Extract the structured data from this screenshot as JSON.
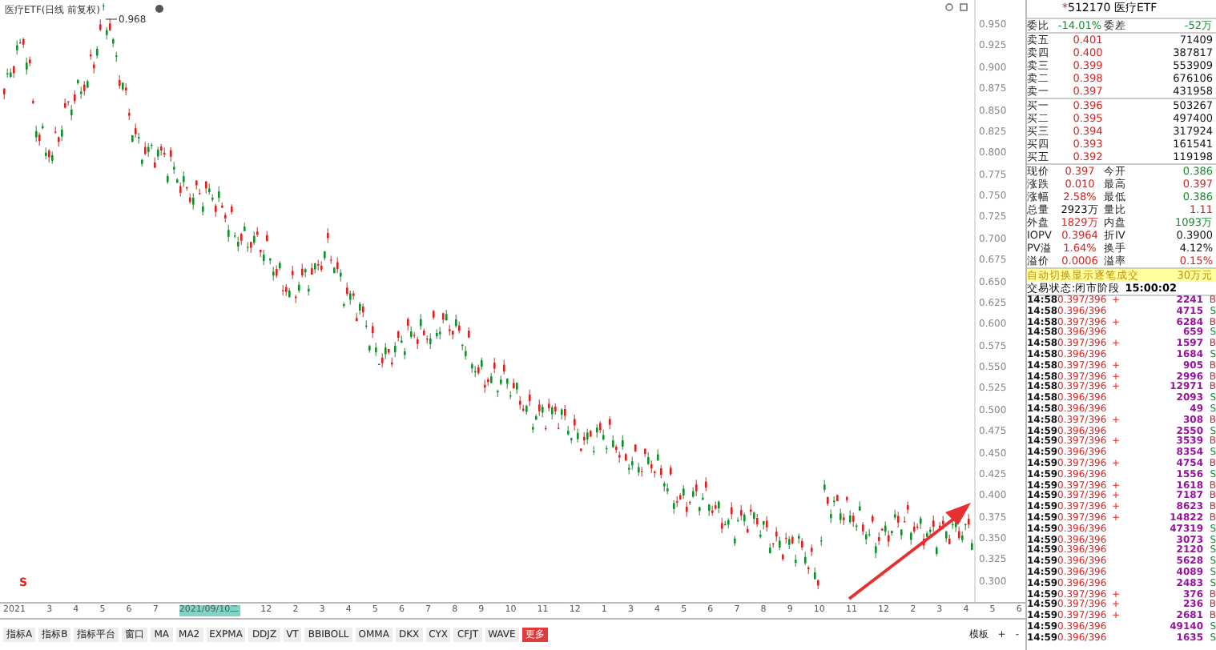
{
  "chart": {
    "title": "医疗ETF(日线 前复权)",
    "peak_label": "0.968",
    "event_marker": "S",
    "price_axis": [
      "0.950",
      "0.925",
      "0.900",
      "0.875",
      "0.850",
      "0.825",
      "0.800",
      "0.775",
      "0.750",
      "0.725",
      "0.700",
      "0.675",
      "0.650",
      "0.625",
      "0.600",
      "0.575",
      "0.550",
      "0.525",
      "0.500",
      "0.475",
      "0.450",
      "0.425",
      "0.400",
      "0.375",
      "0.350",
      "0.325",
      "0.300"
    ],
    "time_axis": [
      {
        "label": "2021",
        "selected": false
      },
      {
        "label": "3",
        "selected": false
      },
      {
        "label": "4",
        "selected": false
      },
      {
        "label": "5",
        "selected": false
      },
      {
        "label": "6",
        "selected": false
      },
      {
        "label": "7",
        "selected": false
      },
      {
        "label": "2021/09/10二",
        "selected": true
      },
      {
        "label": "12",
        "selected": false
      },
      {
        "label": "2",
        "selected": false
      },
      {
        "label": "3",
        "selected": false
      },
      {
        "label": "4",
        "selected": false
      },
      {
        "label": "5",
        "selected": false
      },
      {
        "label": "6",
        "selected": false
      },
      {
        "label": "7",
        "selected": false
      },
      {
        "label": "8",
        "selected": false
      },
      {
        "label": "9",
        "selected": false
      },
      {
        "label": "10",
        "selected": false
      },
      {
        "label": "11",
        "selected": false
      },
      {
        "label": "12",
        "selected": false
      },
      {
        "label": "1",
        "selected": false
      },
      {
        "label": "3",
        "selected": false
      },
      {
        "label": "4",
        "selected": false
      },
      {
        "label": "5",
        "selected": false
      },
      {
        "label": "6",
        "selected": false
      },
      {
        "label": "7",
        "selected": false
      },
      {
        "label": "8",
        "selected": false
      },
      {
        "label": "9",
        "selected": false
      },
      {
        "label": "10",
        "selected": false
      },
      {
        "label": "11",
        "selected": false
      },
      {
        "label": "12",
        "selected": false
      },
      {
        "label": "2",
        "selected": false
      },
      {
        "label": "3",
        "selected": false
      },
      {
        "label": "4",
        "selected": false
      },
      {
        "label": "5",
        "selected": false
      },
      {
        "label": "6",
        "selected": false
      }
    ]
  },
  "indicator_tabs": [
    {
      "label": "指标A",
      "selected": false
    },
    {
      "label": "指标B",
      "selected": false
    },
    {
      "label": "指标平台",
      "selected": false
    },
    {
      "label": "窗口",
      "selected": false
    },
    {
      "label": "MA",
      "selected": false
    },
    {
      "label": "MA2",
      "selected": false
    },
    {
      "label": "EXPMA",
      "selected": false
    },
    {
      "label": "DDJZ",
      "selected": false
    },
    {
      "label": "VT",
      "selected": false
    },
    {
      "label": "BBIBOLL",
      "selected": false
    },
    {
      "label": "OMMA",
      "selected": false
    },
    {
      "label": "DKX",
      "selected": false
    },
    {
      "label": "CYX",
      "selected": false
    },
    {
      "label": "CFJT",
      "selected": false
    },
    {
      "label": "WAVE",
      "selected": false
    },
    {
      "label": "更多",
      "selected": true
    }
  ],
  "template_controls": [
    "模板",
    "+",
    "-"
  ],
  "quote_panel": {
    "title": "512170 医疗ETF",
    "star": "*",
    "order_ratio": [
      {
        "label": "委比",
        "value": "-14.01%",
        "color": "#10902c"
      },
      {
        "label": "委差",
        "value": "-52万",
        "color": "#10902c"
      }
    ],
    "asks": [
      {
        "label": "卖五",
        "price": "0.401",
        "volume": "71409"
      },
      {
        "label": "卖四",
        "price": "0.400",
        "volume": "387817"
      },
      {
        "label": "卖三",
        "price": "0.399",
        "volume": "553909"
      },
      {
        "label": "卖二",
        "price": "0.398",
        "volume": "676106"
      },
      {
        "label": "卖一",
        "price": "0.397",
        "volume": "431958"
      }
    ],
    "bids": [
      {
        "label": "买一",
        "price": "0.396",
        "volume": "503267"
      },
      {
        "label": "买二",
        "price": "0.395",
        "volume": "497400"
      },
      {
        "label": "买三",
        "price": "0.394",
        "volume": "317924"
      },
      {
        "label": "买四",
        "price": "0.393",
        "volume": "161541"
      },
      {
        "label": "买五",
        "price": "0.392",
        "volume": "119198"
      }
    ],
    "stats": [
      {
        "label": "现价",
        "value": "0.397",
        "color": "#e02020"
      },
      {
        "label": "今开",
        "value": "0.386",
        "color": "#10902c"
      },
      {
        "label": "涨跌",
        "value": "0.010",
        "color": "#e02020"
      },
      {
        "label": "最高",
        "value": "0.397",
        "color": "#e02020"
      },
      {
        "label": "涨幅",
        "value": "2.58%",
        "color": "#e02020"
      },
      {
        "label": "最低",
        "value": "0.386",
        "color": "#10902c"
      },
      {
        "label": "总量",
        "value": "2923万",
        "color": "#111111"
      },
      {
        "label": "量比",
        "value": "1.11",
        "color": "#e02020"
      },
      {
        "label": "外盘",
        "value": "1829万",
        "color": "#e02020"
      },
      {
        "label": "内盘",
        "value": "1093万",
        "color": "#10902c"
      },
      {
        "label": "IOPV",
        "value": "0.3964",
        "color": "#e02020"
      },
      {
        "label": "折IV",
        "value": "0.3900",
        "color": "#111111"
      },
      {
        "label": "PV溢",
        "value": "1.64%",
        "color": "#e02020"
      },
      {
        "label": "换手",
        "value": "4.12%",
        "color": "#111111"
      },
      {
        "label": "溢价",
        "value": "0.0006",
        "color": "#e02020"
      },
      {
        "label": "溢率",
        "value": "0.15%",
        "color": "#e02020"
      }
    ],
    "notice": {
      "text": "自动切换显示逐笔成交",
      "value": "30万元"
    },
    "trading_status": {
      "text": "交易状态:闭市阶段",
      "time": "15:00:02"
    },
    "ticks": [
      {
        "time": "14:58",
        "price": "0.397/396",
        "flag": "+",
        "volume": "2241",
        "side": "B",
        "color": "#e02020"
      },
      {
        "time": "14:58",
        "price": "0.396/396",
        "volume": "4715",
        "side": "S",
        "color": "#10902c"
      },
      {
        "time": "14:58",
        "price": "0.397/396",
        "flag": "+",
        "volume": "6284",
        "side": "B",
        "color": "#e02020"
      },
      {
        "time": "14:58",
        "price": "0.396/396",
        "volume": "659",
        "side": "S",
        "color": "#10902c"
      },
      {
        "time": "14:58",
        "price": "0.397/396",
        "flag": "+",
        "volume": "1597",
        "side": "B",
        "color": "#e02020"
      },
      {
        "time": "14:58",
        "price": "0.396/396",
        "volume": "1684",
        "side": "S",
        "color": "#10902c"
      },
      {
        "time": "14:58",
        "price": "0.397/396",
        "flag": "+",
        "volume": "905",
        "side": "B",
        "color": "#e02020"
      },
      {
        "time": "14:58",
        "price": "0.397/396",
        "flag": "+",
        "volume": "2996",
        "side": "B",
        "color": "#e02020"
      },
      {
        "time": "14:58",
        "price": "0.397/396",
        "flag": "+",
        "volume": "12971",
        "side": "B",
        "color": "#e02020"
      },
      {
        "time": "14:58",
        "price": "0.396/396",
        "volume": "2093",
        "side": "S",
        "color": "#10902c"
      },
      {
        "time": "14:58",
        "price": "0.396/396",
        "volume": "49",
        "side": "S",
        "color": "#10902c"
      },
      {
        "time": "14:58",
        "price": "0.397/396",
        "flag": "+",
        "volume": "308",
        "side": "B",
        "color": "#e02020"
      },
      {
        "time": "14:59",
        "price": "0.396/396",
        "volume": "2550",
        "side": "S",
        "color": "#10902c"
      },
      {
        "time": "14:59",
        "price": "0.397/396",
        "flag": "+",
        "volume": "3539",
        "side": "B",
        "color": "#e02020"
      },
      {
        "time": "14:59",
        "price": "0.396/396",
        "volume": "8354",
        "side": "S",
        "color": "#10902c"
      },
      {
        "time": "14:59",
        "price": "0.397/396",
        "flag": "+",
        "volume": "4754",
        "side": "B",
        "color": "#e02020"
      },
      {
        "time": "14:59",
        "price": "0.396/396",
        "volume": "1556",
        "side": "S",
        "color": "#10902c"
      },
      {
        "time": "14:59",
        "price": "0.397/396",
        "flag": "+",
        "volume": "1618",
        "side": "B",
        "color": "#e02020"
      },
      {
        "time": "14:59",
        "price": "0.397/396",
        "flag": "+",
        "volume": "7187",
        "side": "B",
        "color": "#e02020"
      },
      {
        "time": "14:59",
        "price": "0.397/396",
        "flag": "+",
        "volume": "8623",
        "side": "B",
        "color": "#e02020"
      },
      {
        "time": "14:59",
        "price": "0.397/396",
        "flag": "+",
        "volume": "14822",
        "side": "B",
        "color": "#e02020"
      },
      {
        "time": "14:59",
        "price": "0.396/396",
        "volume": "47319",
        "side": "S",
        "color": "#10902c"
      },
      {
        "time": "14:59",
        "price": "0.396/396",
        "volume": "3073",
        "side": "S",
        "color": "#10902c"
      },
      {
        "time": "14:59",
        "price": "0.396/396",
        "volume": "2120",
        "side": "S",
        "color": "#10902c"
      },
      {
        "time": "14:59",
        "price": "0.396/396",
        "volume": "5628",
        "side": "S",
        "color": "#10902c"
      },
      {
        "time": "14:59",
        "price": "0.396/396",
        "volume": "4089",
        "side": "S",
        "color": "#10902c"
      },
      {
        "time": "14:59",
        "price": "0.396/396",
        "volume": "2483",
        "side": "S",
        "color": "#10902c"
      },
      {
        "time": "14:59",
        "price": "0.397/396",
        "flag": "+",
        "volume": "376",
        "side": "B",
        "color": "#e02020"
      },
      {
        "time": "14:59",
        "price": "0.397/396",
        "flag": "+",
        "volume": "236",
        "side": "B",
        "color": "#e02020"
      },
      {
        "time": "14:59",
        "price": "0.397/396",
        "flag": "+",
        "volume": "2681",
        "side": "B",
        "color": "#e02020"
      },
      {
        "time": "14:59",
        "price": "0.396/396",
        "volume": "49140",
        "side": "S",
        "color": "#10902c"
      },
      {
        "time": "14:59",
        "price": "0.396/396",
        "volume": "1635",
        "side": "S",
        "color": "#10902c"
      }
    ]
  }
}
